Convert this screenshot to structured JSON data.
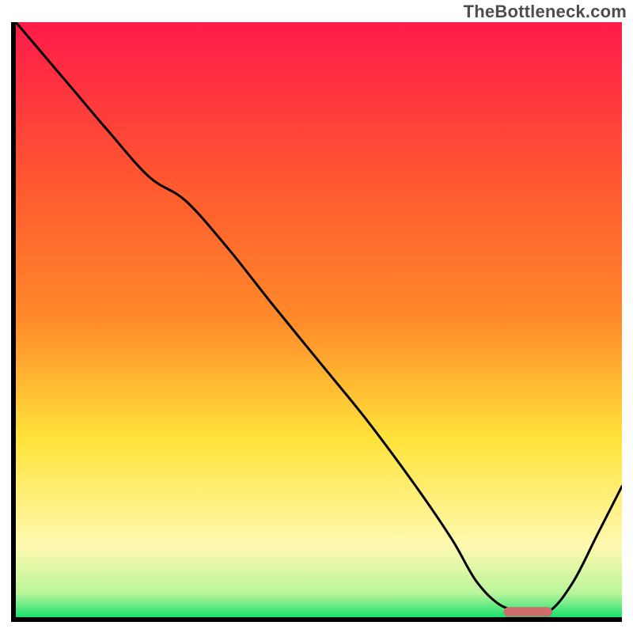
{
  "watermark": "TheBottleneck.com",
  "chart_data": {
    "type": "line",
    "title": "",
    "subtitle": "",
    "xlabel": "",
    "ylabel": "",
    "xlim": [
      0,
      100
    ],
    "ylim": [
      0,
      100
    ],
    "grid": false,
    "legend": false,
    "x": [
      0,
      5,
      10,
      15,
      22,
      28,
      35,
      42,
      50,
      58,
      66,
      72,
      76,
      80,
      84,
      88,
      92,
      96,
      100
    ],
    "values": [
      100,
      94,
      88,
      82,
      74,
      70,
      62,
      53,
      43,
      33,
      22,
      13,
      6,
      2,
      1,
      1,
      6,
      14,
      22
    ],
    "marker": {
      "x_start": 80.5,
      "x_end": 88.5,
      "y": 0.9
    },
    "annotations": []
  },
  "colors": {
    "gradient_top": "#ff1a4a",
    "gradient_mid_orange": "#ff8a2a",
    "gradient_mid_yellow": "#ffe33a",
    "gradient_pale_yellow": "#fff9b0",
    "gradient_bottom": "#19e070",
    "curve": "#000000",
    "marker": "#cf6b6b",
    "axis": "#000000"
  }
}
